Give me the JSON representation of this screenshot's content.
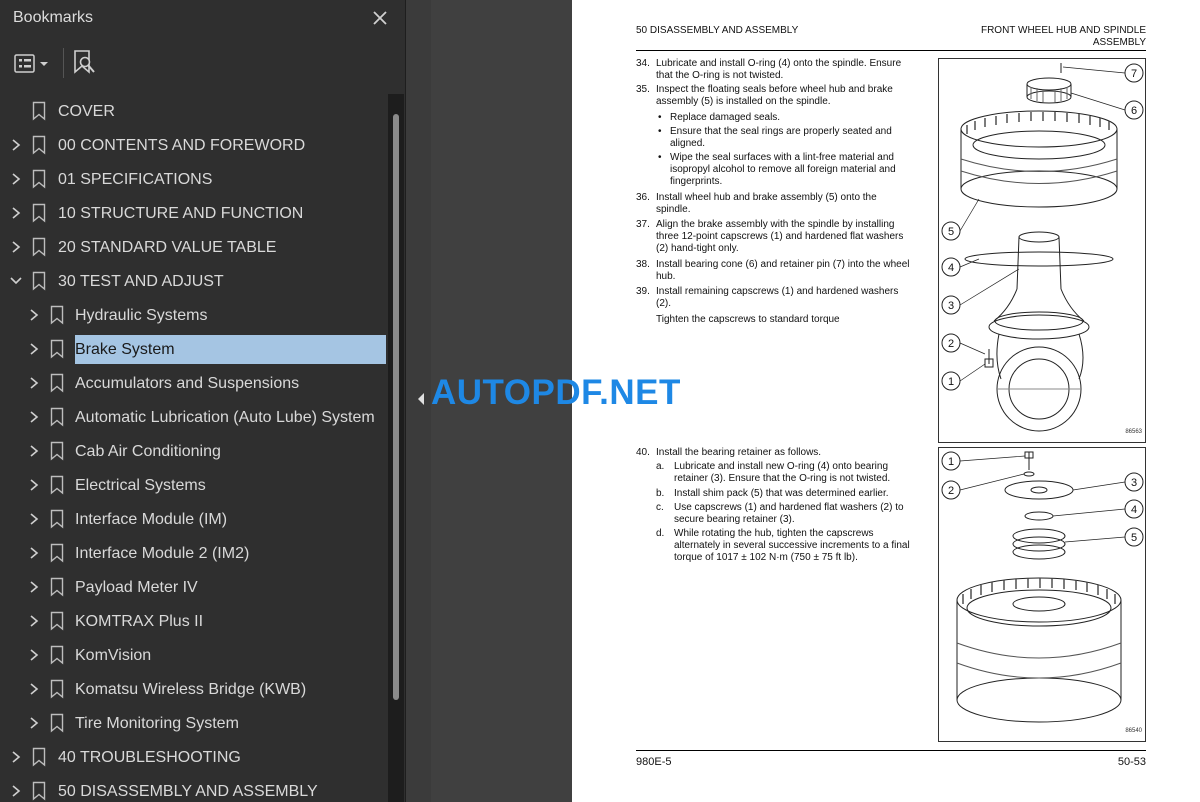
{
  "sidebar": {
    "title": "Bookmarks",
    "close_icon": "close-icon",
    "options_icon": "bookmark-options-icon",
    "search_icon": "find-bookmark-icon",
    "items": [
      {
        "label": "COVER",
        "level": 0,
        "expandable": false
      },
      {
        "label": "00 CONTENTS AND FOREWORD",
        "level": 0,
        "expandable": true
      },
      {
        "label": "01 SPECIFICATIONS",
        "level": 0,
        "expandable": true
      },
      {
        "label": "10 STRUCTURE AND FUNCTION",
        "level": 0,
        "expandable": true
      },
      {
        "label": "20 STANDARD VALUE TABLE",
        "level": 0,
        "expandable": true
      },
      {
        "label": "30 TEST AND ADJUST",
        "level": 0,
        "expandable": true,
        "expanded": true
      },
      {
        "label": "Hydraulic Systems",
        "level": 1,
        "expandable": true
      },
      {
        "label": "Brake System",
        "level": 1,
        "expandable": true,
        "selected": true
      },
      {
        "label": "Accumulators and Suspensions",
        "level": 1,
        "expandable": true
      },
      {
        "label": "Automatic Lubrication (Auto Lube) System",
        "level": 1,
        "expandable": true
      },
      {
        "label": "Cab Air Conditioning",
        "level": 1,
        "expandable": true
      },
      {
        "label": "Electrical Systems",
        "level": 1,
        "expandable": true
      },
      {
        "label": "Interface Module (IM)",
        "level": 1,
        "expandable": true
      },
      {
        "label": "Interface Module 2 (IM2)",
        "level": 1,
        "expandable": true
      },
      {
        "label": "Payload Meter IV",
        "level": 1,
        "expandable": true
      },
      {
        "label": "KOMTRAX Plus II",
        "level": 1,
        "expandable": true
      },
      {
        "label": "KomVision",
        "level": 1,
        "expandable": true
      },
      {
        "label": "Komatsu Wireless Bridge (KWB)",
        "level": 1,
        "expandable": true
      },
      {
        "label": "Tire Monitoring System",
        "level": 1,
        "expandable": true
      },
      {
        "label": "40 TROUBLESHOOTING",
        "level": 0,
        "expandable": true
      },
      {
        "label": "50 DISASSEMBLY AND ASSEMBLY",
        "level": 0,
        "expandable": true
      }
    ]
  },
  "watermark": "AUTOPDF.NET",
  "page": {
    "header_left": "50 DISASSEMBLY AND ASSEMBLY",
    "header_right_1": "FRONT WHEEL HUB AND SPINDLE",
    "header_right_2": "ASSEMBLY",
    "steps": [
      {
        "num": "34.",
        "lines": [
          "Lubricate and install O-ring (4) onto the spindle. Ensure",
          "that the O-ring is not twisted."
        ]
      },
      {
        "num": "35.",
        "lines": [
          "Inspect the floating seals before wheel hub and brake",
          "assembly (5) is installed on the spindle."
        ]
      },
      {
        "num": "36.",
        "lines": [
          "Install wheel hub and brake assembly (5) onto the",
          "spindle."
        ]
      },
      {
        "num": "37.",
        "lines": [
          "Align the brake assembly with the spindle by installing",
          "three 12-point capscrews (1) and hardened flat washers",
          "(2) hand-tight only."
        ]
      },
      {
        "num": "38.",
        "lines": [
          "Install bearing cone (6) and retainer pin (7) into the wheel",
          "hub."
        ]
      },
      {
        "num": "39.",
        "lines": [
          "Install remaining capscrews (1) and hardened washers",
          "(2)."
        ]
      },
      {
        "num": "40.",
        "lines": [
          "Install the bearing retainer as follows."
        ]
      }
    ],
    "bullets": [
      {
        "lines": [
          "Replace damaged seals."
        ]
      },
      {
        "lines": [
          "Ensure that the seal rings are properly seated and",
          "aligned."
        ]
      },
      {
        "lines": [
          "Wipe the seal surfaces with a lint-free material and",
          "isopropyl alcohol to remove all foreign material and",
          "fingerprints."
        ]
      }
    ],
    "bullet_char": "•",
    "torque_note": "Tighten the capscrews to standard torque",
    "substeps": [
      {
        "letter": "a.",
        "lines": [
          "Lubricate and install new O-ring (4) onto bearing",
          "retainer (3). Ensure that the O-ring is not twisted."
        ]
      },
      {
        "letter": "b.",
        "lines": [
          "Install shim pack (5) that was determined earlier."
        ]
      },
      {
        "letter": "c.",
        "lines": [
          "Use capscrews (1) and hardened flat washers (2) to",
          "secure bearing retainer (3)."
        ]
      },
      {
        "letter": "d.",
        "lines": [
          "While rotating the hub, tighten the capscrews",
          "alternately in several successive increments to a final",
          "torque of 1017 ± 102 N·m (750 ± 75 ft lb)."
        ]
      }
    ],
    "fig1_id": "86563",
    "fig2_id": "86540",
    "fig1_callouts": [
      "7",
      "6",
      "5",
      "4",
      "3",
      "2",
      "1"
    ],
    "fig2_callouts": [
      "1",
      "2",
      "3",
      "4",
      "5"
    ],
    "footer_left": "980E-5",
    "footer_right": "50-53"
  }
}
